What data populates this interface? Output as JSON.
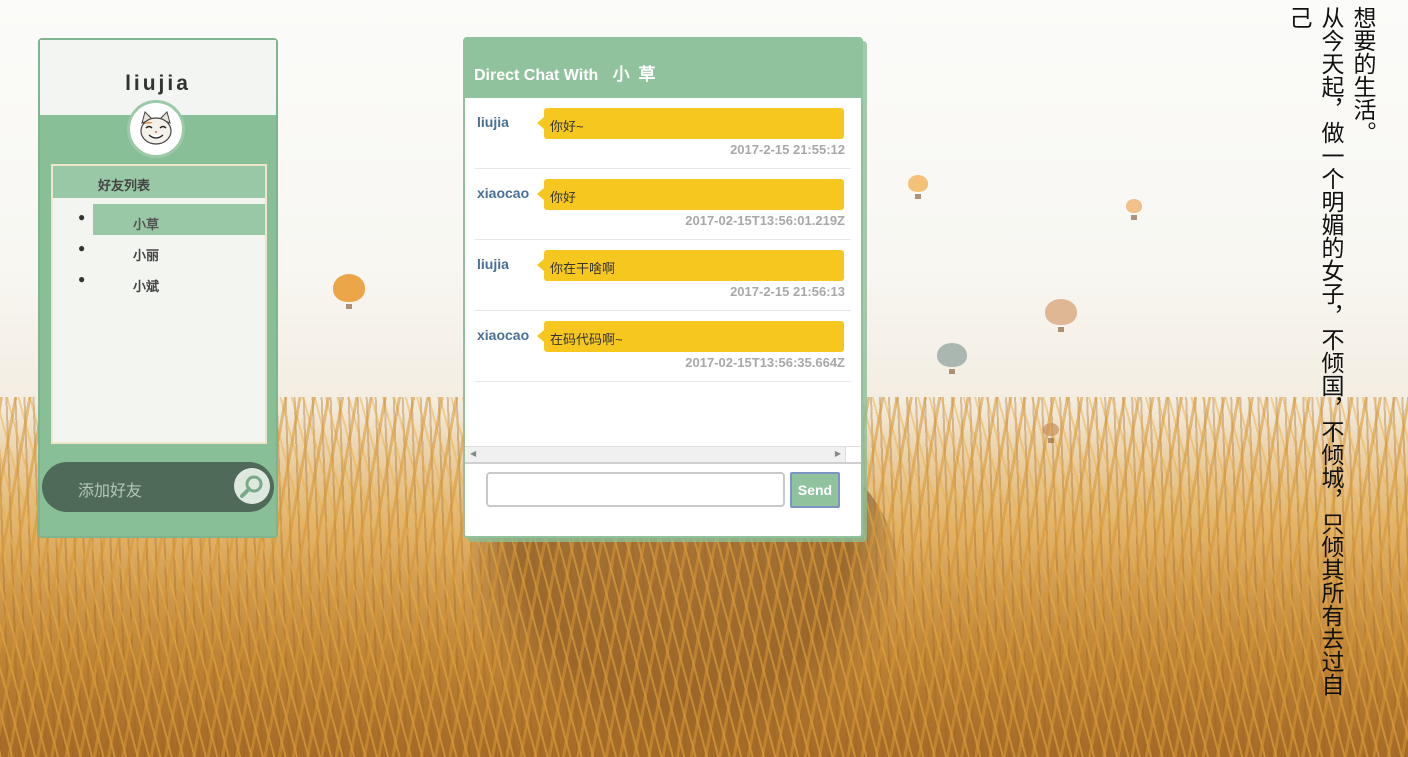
{
  "user": {
    "name": "liujia"
  },
  "friends": {
    "header": "好友列表",
    "items": [
      {
        "label": "小草",
        "active": true
      },
      {
        "label": "小丽",
        "active": false
      },
      {
        "label": "小斌",
        "active": false
      }
    ]
  },
  "add_friend": {
    "placeholder": "添加好友"
  },
  "chat": {
    "title_prefix": "Direct Chat With",
    "partner": "小 草",
    "messages": [
      {
        "sender": "liujia",
        "text": "你好~",
        "time": "2017-2-15 21:55:12"
      },
      {
        "sender": "xiaocao",
        "text": "你好",
        "time": "2017-02-15T13:56:01.219Z"
      },
      {
        "sender": "liujia",
        "text": "你在干啥啊",
        "time": "2017-2-15 21:56:13"
      },
      {
        "sender": "xiaocao",
        "text": "在码代码啊~",
        "time": "2017-02-15T13:56:35.664Z"
      }
    ],
    "input_value": "",
    "send_label": "Send"
  },
  "poem": {
    "line1": "想要的生活。",
    "line2": "从今天起，做一个明媚的女子，不倾国，不倾城，只倾其所有去过自己"
  },
  "colors": {
    "panel_green": "#88bf96",
    "header_green": "#90c39d",
    "bubble_yellow": "#f6c81f",
    "sender_blue": "#4c6f94"
  },
  "icons": {
    "avatar": "cat-avatar-icon",
    "search": "magnifier-icon"
  }
}
